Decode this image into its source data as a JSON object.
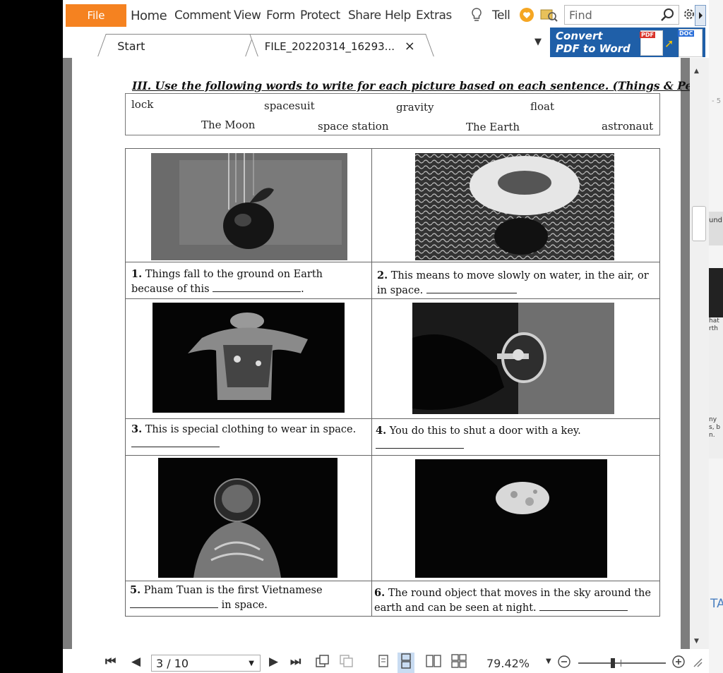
{
  "menu": {
    "file": "File",
    "items": [
      "Home",
      "Comment",
      "View",
      "Form",
      "Protect",
      "Share",
      "Help",
      "Extras"
    ],
    "tell": "Tell",
    "find_placeholder": "Find"
  },
  "tabs": {
    "start": "Start",
    "document": "FILE_20220314_16293...",
    "close": "×"
  },
  "convert": {
    "line1": "Convert",
    "line2": "PDF to Word",
    "pdf_badge": "PDF",
    "doc_badge": "DOC"
  },
  "worksheet": {
    "heading": "III. Use the following words to write for each picture based on each sentence. (Things & People)",
    "words": [
      "lock",
      "spacesuit",
      "gravity",
      "float",
      "The Moon",
      "space station",
      "The Earth",
      "astronaut"
    ],
    "questions": [
      {
        "num": "1.",
        "text_a": "Things fall to the ground on Earth because of this",
        "text_b": "."
      },
      {
        "num": "2.",
        "text_a": "This means to move slowly on water, in the air, or in space.",
        "text_b": ""
      },
      {
        "num": "3.",
        "text_a": "This is special clothing to wear in space.",
        "text_b": ""
      },
      {
        "num": "4.",
        "text_a": "You do this to shut a door with a key.",
        "text_b": ""
      },
      {
        "num": "5.",
        "text_a": "Pham Tuan is the first Vietnamese",
        "text_b": "in space."
      },
      {
        "num": "6.",
        "text_a": "The round object that moves in the sky around the earth and can be seen at night.",
        "text_b": ""
      }
    ],
    "pictures": [
      "apple-falling-photo",
      "swim-ring-on-water-photo",
      "spacesuit-photo",
      "key-in-lock-photo",
      "cosmonaut-photo",
      "moon-photo"
    ]
  },
  "side_fragments": [
    "und",
    "hat",
    "rth",
    "ny",
    "s, b",
    "n.",
    "TA",
    "- 5"
  ],
  "bottom": {
    "page": "3 / 10",
    "zoom": "79.42%"
  },
  "colors": {
    "file_button": "#f58220",
    "convert_bg": "#1f5fa8",
    "doc_bg": "#7d7d7d"
  }
}
